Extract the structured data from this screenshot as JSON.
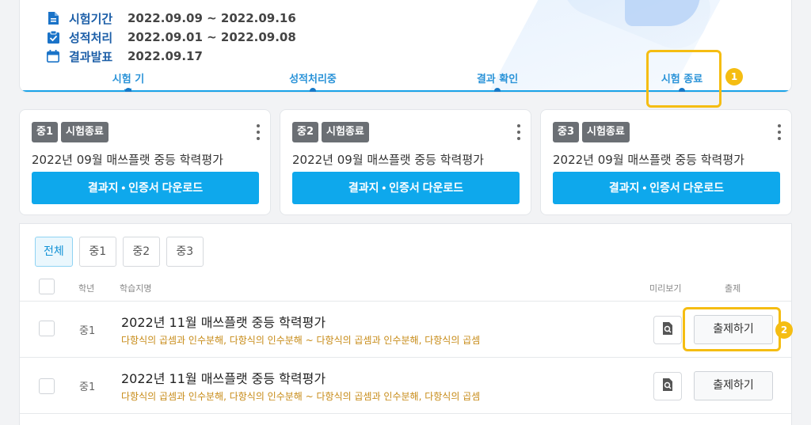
{
  "schedule": {
    "items": [
      {
        "icon": "document-icon",
        "label": "시험기간",
        "value": "2022.09.09 ~ 2022.09.16"
      },
      {
        "icon": "clipboard-check-icon",
        "label": "성적처리",
        "value": "2022.09.01 ~ 2022.09.08"
      },
      {
        "icon": "calendar-icon",
        "label": "결과발표",
        "value": "2022.09.17"
      }
    ],
    "steps": [
      "시험 기간",
      "성적처리중",
      "결과 확인",
      "시험 종료"
    ]
  },
  "annotations": [
    "1",
    "2"
  ],
  "grade_cards": [
    {
      "grade": "중1",
      "status": "시험종료",
      "title": "2022년 09월 매쓰플랫 중등 학력평가",
      "button": "결과지 • 인증서 다운로드"
    },
    {
      "grade": "중2",
      "status": "시험종료",
      "title": "2022년 09월 매쓰플랫 중등 학력평가",
      "button": "결과지 • 인증서 다운로드"
    },
    {
      "grade": "중3",
      "status": "시험종료",
      "title": "2022년 09월 매쓰플랫 중등 학력평가",
      "button": "결과지 • 인증서 다운로드"
    }
  ],
  "filters": [
    "전체",
    "중1",
    "중2",
    "중3"
  ],
  "table": {
    "headers": {
      "grade": "학년",
      "name": "학습지명",
      "preview": "미리보기",
      "submit": "출제"
    },
    "rows": [
      {
        "grade": "중1",
        "name": "2022년 11월 매쓰플랫 중등 학력평가",
        "range": "다항식의 곱셈과 인수분해, 다항식의 인수분해 ~ 다항식의 곱셈과 인수분해, 다항식의 곱셈",
        "button": "출제하기"
      },
      {
        "grade": "중1",
        "name": "2022년 11월 매쓰플랫 중등 학력평가",
        "range": "다항식의 곱셈과 인수분해, 다항식의 인수분해 ~ 다항식의 곱셈과 인수분해, 다항식의 곱셈",
        "button": "출제하기"
      }
    ]
  },
  "colors": {
    "accent": "#0ea8ec",
    "highlight": "#f5bd12",
    "label": "#1d5fa8",
    "range": "#c78b17"
  }
}
